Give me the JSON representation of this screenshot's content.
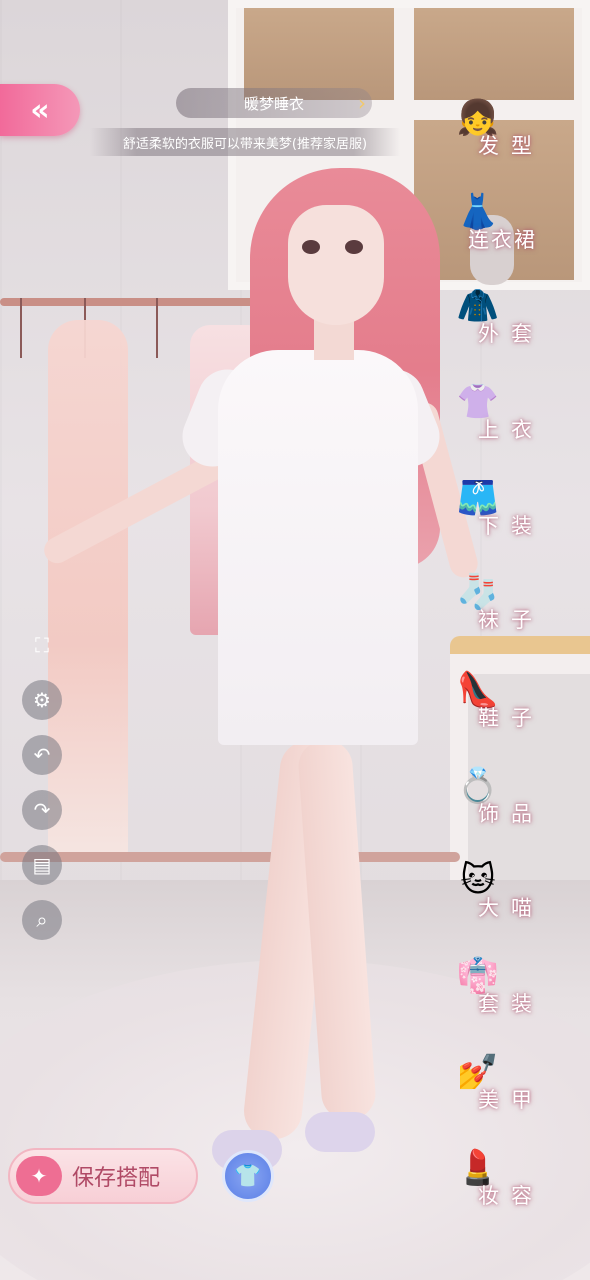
{
  "header": {
    "back_icon": "«",
    "outfit_title": "暖梦睡衣",
    "outfit_description": "舒适柔软的衣服可以带来美梦(推荐家居服)"
  },
  "categories": [
    {
      "label": "发型",
      "icon": "hair-icon",
      "glyph": "👧"
    },
    {
      "label": "连衣裙",
      "icon": "dress-icon",
      "glyph": "👗"
    },
    {
      "label": "外套",
      "icon": "coat-icon",
      "glyph": "🧥"
    },
    {
      "label": "上衣",
      "icon": "shirt-icon",
      "glyph": "👚"
    },
    {
      "label": "下装",
      "icon": "shorts-icon",
      "glyph": "🩳"
    },
    {
      "label": "袜子",
      "icon": "sock-icon",
      "glyph": "🧦"
    },
    {
      "label": "鞋子",
      "icon": "shoe-icon",
      "glyph": "👠"
    },
    {
      "label": "饰品",
      "icon": "accessory-icon",
      "glyph": "💍"
    },
    {
      "label": "大喵",
      "icon": "cat-icon",
      "glyph": "🐱"
    },
    {
      "label": "套装",
      "icon": "outfit-set-icon",
      "glyph": "👘"
    },
    {
      "label": "美甲",
      "icon": "nail-polish-icon",
      "glyph": "💅"
    },
    {
      "label": "妆容",
      "icon": "makeup-icon",
      "glyph": "💄"
    }
  ],
  "tools": [
    {
      "name": "fullscreen-icon",
      "glyph": "⛶"
    },
    {
      "name": "settings-icon",
      "glyph": "⚙"
    },
    {
      "name": "undo-icon",
      "glyph": "↶"
    },
    {
      "name": "redo-icon",
      "glyph": "↷"
    },
    {
      "name": "hanger-icon",
      "glyph": "▤"
    },
    {
      "name": "search-icon",
      "glyph": "⌕"
    }
  ],
  "footer": {
    "save_label": "保存搭配",
    "save_icon": "✦",
    "outfit_icon": "👕"
  },
  "colors": {
    "accent_pink": "#f26a9a",
    "label_glow": "#aa4664",
    "outfit_button_blue": "#5a7fe6"
  }
}
